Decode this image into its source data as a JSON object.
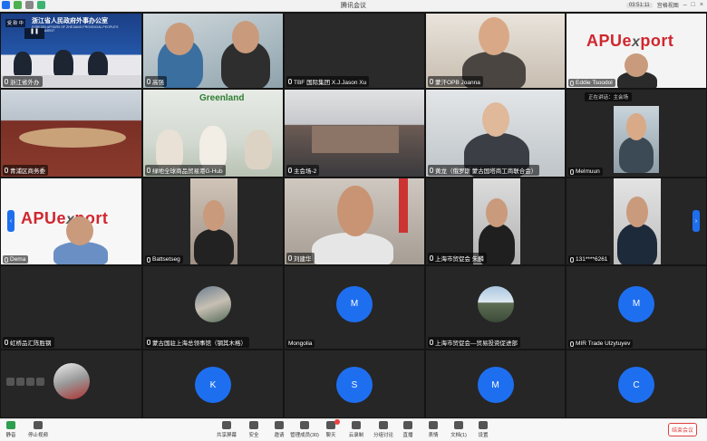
{
  "window": {
    "title": "腾讯会议",
    "time": "03:51:11",
    "view_mode": "宫格视图"
  },
  "tiles": {
    "t0": {
      "label": "浙江省外办",
      "sign": "浙江省人民政府外事办公室",
      "sign_en": "FOREIGN AFFAIRS OF ZHEJIANG PROVINCIAL PEOPLE'S GOVERNMENT",
      "tag": "受 聆 中"
    },
    "t1": {
      "label": "高强"
    },
    "t2": {
      "label": "TBF 国际集团 X.J.Jason Xu"
    },
    "t3": {
      "label": "蒙汗OPB Joanna"
    },
    "t4": {
      "label": "Eddie Tsoodol",
      "logo_main": "APUe",
      "logo_x": "x",
      "logo_rest": "port"
    },
    "t5": {
      "label": "青浦区商务委"
    },
    "t6": {
      "label": "绿地全球商品贸易港G-Hub",
      "logo": "Greenland"
    },
    "t7": {
      "label": "主会场-2"
    },
    "t8": {
      "label": "黄龙（俄罗斯 蒙古国塔商工商联合会）"
    },
    "t9": {
      "label": "Melmuun",
      "speaking": "正在讲话：主会场"
    },
    "t10": {
      "label": "Dema",
      "logo_main": "APUe",
      "logo_x": "x",
      "logo_rest": "port"
    },
    "t11": {
      "label": "Battsetseg"
    },
    "t12": {
      "label": "刘建华"
    },
    "t13": {
      "label": "上海市贸促会 朱麟"
    },
    "t14": {
      "label": "131****6261"
    },
    "t15": {
      "label": "虹桥品汇陈胜钢"
    },
    "t16": {
      "label": "蒙古国驻上海总领事馆（钢其木格）"
    },
    "t17": {
      "label": "Mongolia",
      "initial": "M"
    },
    "t18": {
      "label": "上海市贸促会—贸易投资促进部"
    },
    "t19": {
      "label": "MIR Trade Ulzytuyev",
      "initial": "M"
    },
    "t20": {
      "label": ""
    },
    "t21": {
      "initial": "K"
    },
    "t22": {
      "initial": "S"
    },
    "t23": {
      "initial": "M"
    },
    "t24": {
      "initial": "C"
    }
  },
  "toolbar": {
    "mute": "静音",
    "stop_video": "停止视频",
    "share": "共享屏幕",
    "security": "安全",
    "invite": "邀请",
    "members": "管理成员(30)",
    "chat": "聊天",
    "record": "云录制",
    "breakout": "分组讨论",
    "live": "直播",
    "reactions": "表情",
    "docs": "文档(1)",
    "settings": "设置",
    "end": "结束会议"
  },
  "colors": {
    "avatar_blue": "#1e6ff0",
    "end_red": "#e04040",
    "apu_red": "#d0262e"
  }
}
